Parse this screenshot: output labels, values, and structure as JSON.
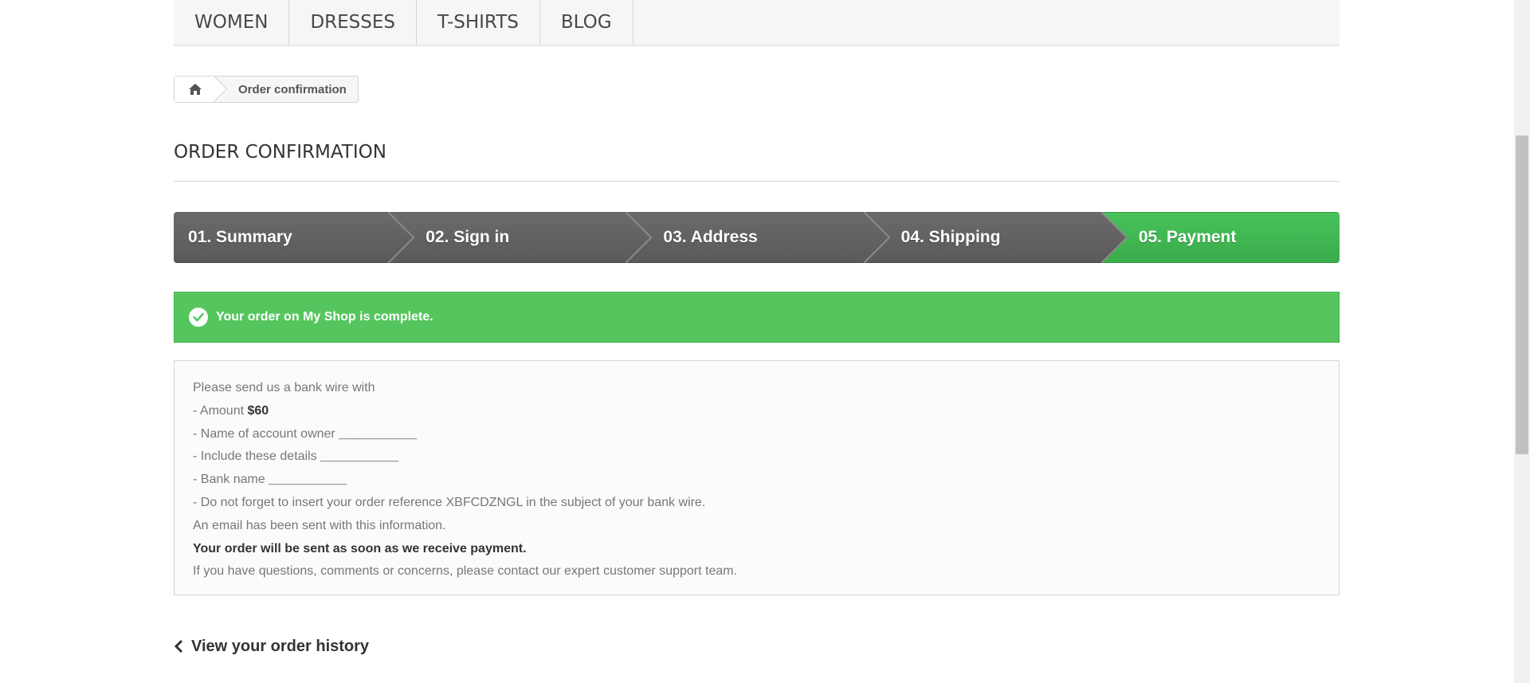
{
  "menu": {
    "items": [
      {
        "label": "WOMEN"
      },
      {
        "label": "DRESSES"
      },
      {
        "label": "T-SHIRTS"
      },
      {
        "label": "BLOG"
      }
    ]
  },
  "breadcrumb": {
    "home_icon": "home-icon",
    "current": "Order confirmation"
  },
  "page": {
    "title": "ORDER CONFIRMATION"
  },
  "steps": [
    {
      "label": "01. Summary",
      "active": false
    },
    {
      "label": "02. Sign in",
      "active": false
    },
    {
      "label": "03. Address",
      "active": false
    },
    {
      "label": "04. Shipping",
      "active": false
    },
    {
      "label": "05. Payment",
      "active": true
    }
  ],
  "alert": {
    "icon": "check-circle-icon",
    "message": "Your order on My Shop is complete.",
    "color": "#55c65e"
  },
  "bank_wire": {
    "intro": "Please send us a bank wire with",
    "amount_label": "- Amount ",
    "amount_value": "$60",
    "owner_label": "- Name of account owner ",
    "owner_value": "___________",
    "details_label": "- Include these details ",
    "details_value": "___________",
    "bank_label": "- Bank name ",
    "bank_value": "___________",
    "reference_line": "- Do not forget to insert your order reference XBFCDZNGL in the subject of your bank wire.",
    "email_line": "An email has been sent with this information.",
    "shipping_line": "Your order will be sent as soon as we receive payment.",
    "support_line": "If you have questions, comments or concerns, please contact our expert customer support team."
  },
  "history_link": {
    "icon": "chevron-left-icon",
    "label": "View your order history"
  }
}
